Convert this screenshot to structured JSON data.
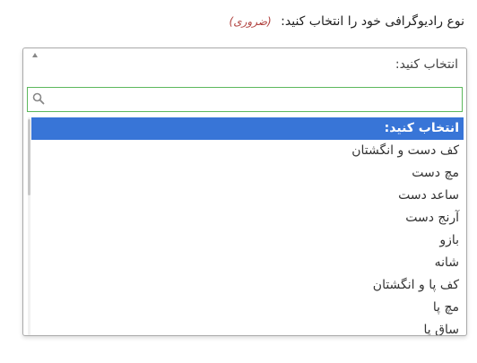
{
  "field": {
    "label": "نوع رادیوگرافی خود را انتخاب کنید:",
    "required_note": "(ضروری)"
  },
  "dropdown": {
    "selected": "انتخاب کنید:",
    "search_value": "",
    "search_icon": "search-icon",
    "toggle_icon": "chevron-up-icon",
    "accent_color": "#3875d7",
    "search_border_color": "#5cb85c",
    "highlighted_index": 0,
    "options": [
      "انتخاب کنید:",
      "کف دست و انگشتان",
      "مچ دست",
      "ساعد دست",
      "آرنج دست",
      "بازو",
      "شانه",
      "کف پا و انگشتان",
      "مچ پا",
      "ساق پا"
    ]
  }
}
